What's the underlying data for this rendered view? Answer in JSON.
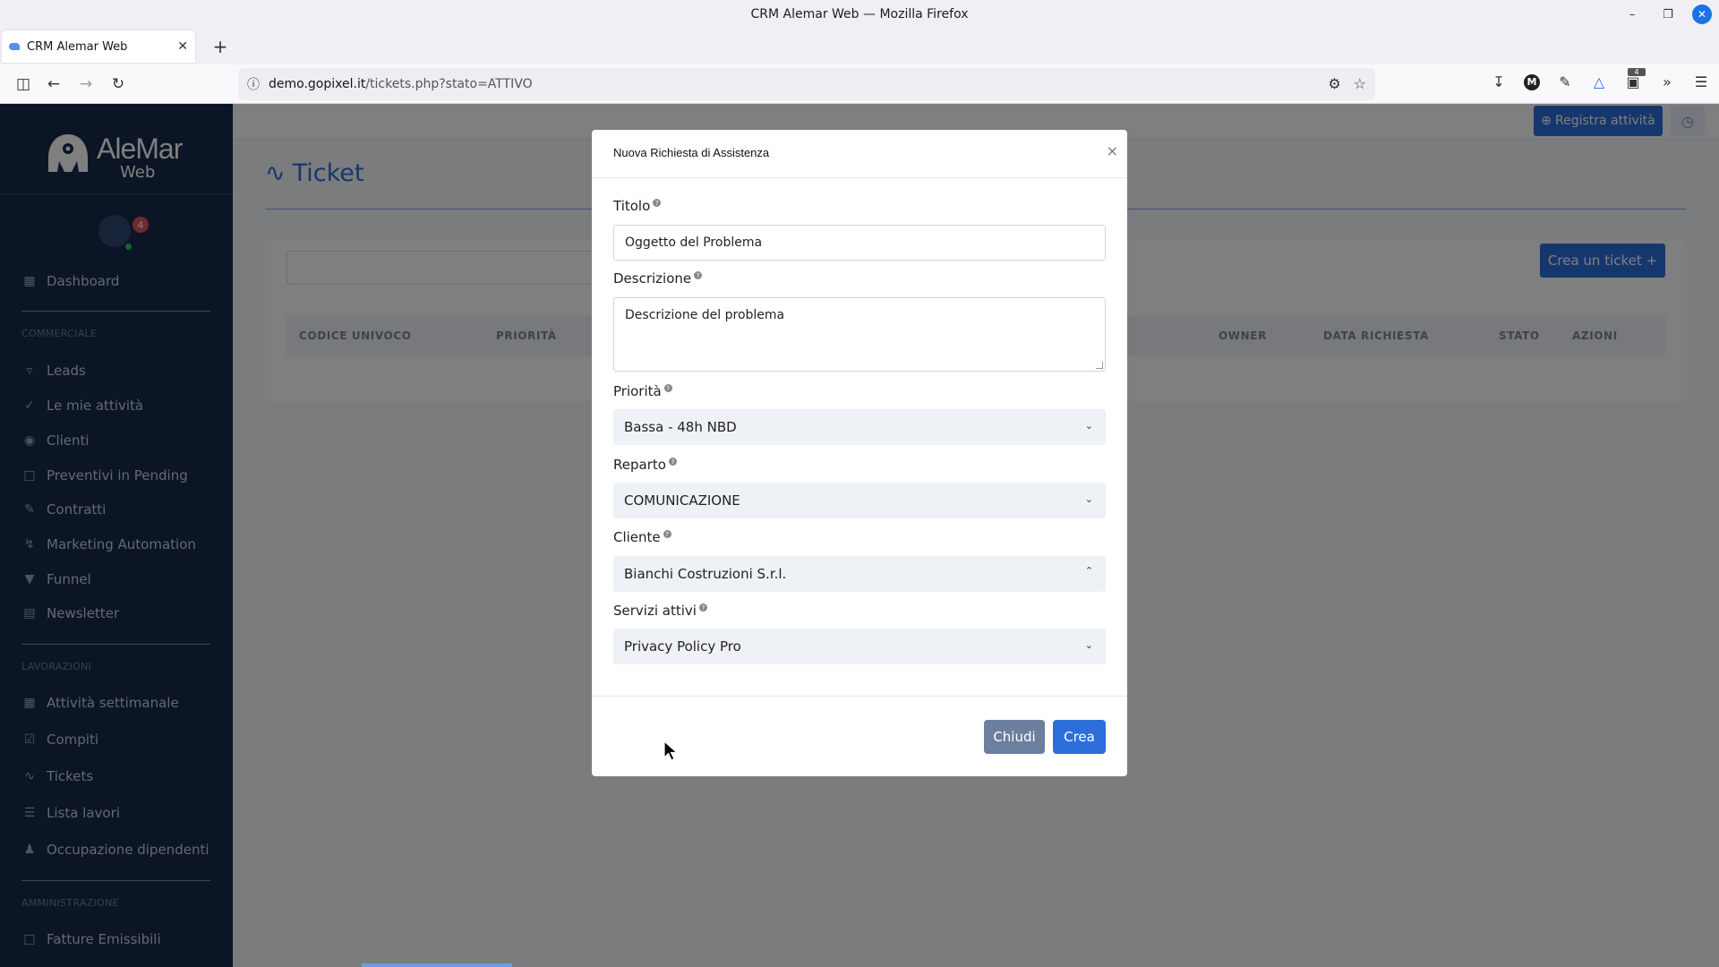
{
  "browser": {
    "window_title": "CRM Alemar Web — Mozilla Firefox",
    "tab_title": "CRM Alemar Web",
    "url_domain": "demo.gopixel.it",
    "url_path": "/tickets.php?stato=ATTIVO",
    "extension_badge": "4"
  },
  "sidebar": {
    "logo_text": "AleMar",
    "logo_sub": "Web",
    "notification_count": "4",
    "dashboard": "Dashboard",
    "section_commerciale": "COMMERCIALE",
    "commerciale_items": [
      {
        "label": "Leads",
        "icon": "filter-icon"
      },
      {
        "label": "Le mie attività",
        "icon": "check-circle-icon"
      },
      {
        "label": "Clienti",
        "icon": "target-icon"
      },
      {
        "label": "Preventivi in Pending",
        "icon": "file-icon"
      },
      {
        "label": "Contratti",
        "icon": "edit-icon"
      },
      {
        "label": "Marketing Automation",
        "icon": "bolt-icon"
      },
      {
        "label": "Funnel",
        "icon": "funnel-icon"
      },
      {
        "label": "Newsletter",
        "icon": "newsletter-icon"
      }
    ],
    "section_lavorazioni": "LAVORAZIONI",
    "lavorazioni_items": [
      {
        "label": "Attività settimanale",
        "icon": "calendar-icon"
      },
      {
        "label": "Compiti",
        "icon": "checkbox-icon"
      },
      {
        "label": "Tickets",
        "icon": "activity-icon"
      },
      {
        "label": "Lista lavori",
        "icon": "list-icon"
      },
      {
        "label": "Occupazione dipendenti",
        "icon": "users-icon"
      }
    ],
    "section_amministrazione": "AMMINISTRAZIONE",
    "amministrazione_items": [
      {
        "label": "Fatture Emissibili",
        "icon": "invoice-icon"
      }
    ]
  },
  "main": {
    "register_button": "Registra attività",
    "page_title": "Ticket",
    "create_ticket_button": "Crea un ticket +",
    "table_headers": [
      "CODICE UNIVOCO",
      "PRIORITÀ",
      "OWNER",
      "DATA RICHIESTA",
      "STATO",
      "AZIONI"
    ]
  },
  "modal": {
    "title": "Nuova Richiesta di Assistenza",
    "fields": {
      "titolo_label": "Titolo",
      "titolo_value": "Oggetto del Problema",
      "descrizione_label": "Descrizione",
      "descrizione_value": "Descrizione del problema",
      "priorita_label": "Priorità",
      "priorita_value": "Bassa - 48h NBD",
      "reparto_label": "Reparto",
      "reparto_value": "COMUNICAZIONE",
      "cliente_label": "Cliente",
      "cliente_value": "Bianchi Costruzioni S.r.l.",
      "servizi_label": "Servizi attivi",
      "servizi_value": "Privacy Policy Pro"
    },
    "close_button": "Chiudi",
    "create_button": "Crea"
  },
  "colors": {
    "accent": "#2c6fdb",
    "sidebar_bg": "#162b4b",
    "secondary_button": "#6b7f9e"
  }
}
